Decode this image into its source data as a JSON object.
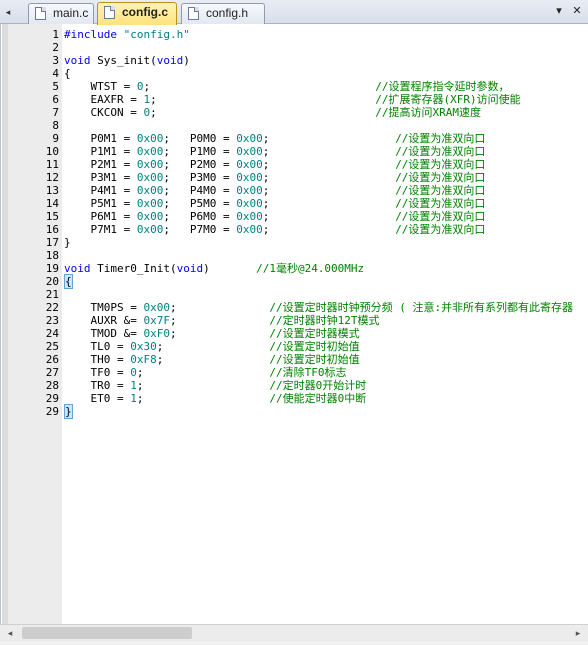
{
  "tabs": [
    {
      "label": "main.c",
      "active": false
    },
    {
      "label": "config.c",
      "active": true
    },
    {
      "label": "config.h",
      "active": false
    }
  ],
  "tabbar": {
    "left_arrow": "◂",
    "dropdown_icon": "▾",
    "close_icon": "✕"
  },
  "colors": {
    "keyword": "#0000ff",
    "number": "#008080",
    "comment": "#008000",
    "active_tab": "#ffe27a"
  },
  "code": [
    {
      "n": "1",
      "segs": [
        [
          "pre",
          "#include "
        ],
        [
          "str",
          "\"config.h\""
        ]
      ]
    },
    {
      "n": "2",
      "segs": []
    },
    {
      "n": "3",
      "segs": [
        [
          "kw",
          "void"
        ],
        [
          "",
          " Sys_init("
        ],
        [
          "kw",
          "void"
        ],
        [
          "",
          ")"
        ]
      ]
    },
    {
      "n": "4",
      "segs": [
        [
          "",
          "{"
        ]
      ]
    },
    {
      "n": "5",
      "segs": [
        [
          "",
          "    WTST = "
        ],
        [
          "num",
          "0"
        ],
        [
          "",
          ";"
        ],
        [
          "",
          "                                  "
        ],
        [
          "cm",
          "//设置程序指令延时参数，"
        ]
      ]
    },
    {
      "n": "6",
      "segs": [
        [
          "",
          "    EAXFR = "
        ],
        [
          "num",
          "1"
        ],
        [
          "",
          ";"
        ],
        [
          "",
          "                                 "
        ],
        [
          "cm",
          "//扩展寄存器(XFR)访问使能"
        ]
      ]
    },
    {
      "n": "7",
      "segs": [
        [
          "",
          "    CKCON = "
        ],
        [
          "num",
          "0"
        ],
        [
          "",
          ";"
        ],
        [
          "",
          "                                 "
        ],
        [
          "cm",
          "//提高访问XRAM速度"
        ]
      ]
    },
    {
      "n": "8",
      "segs": []
    },
    {
      "n": "9",
      "segs": [
        [
          "",
          "    P0M1 = "
        ],
        [
          "num",
          "0x00"
        ],
        [
          "",
          ";   P0M0 = "
        ],
        [
          "num",
          "0x00"
        ],
        [
          "",
          ";"
        ],
        [
          "",
          "                   "
        ],
        [
          "cm",
          "//设置为准双向口"
        ]
      ]
    },
    {
      "n": "10",
      "segs": [
        [
          "",
          "    P1M1 = "
        ],
        [
          "num",
          "0x00"
        ],
        [
          "",
          ";   P1M0 = "
        ],
        [
          "num",
          "0x00"
        ],
        [
          "",
          ";"
        ],
        [
          "",
          "                   "
        ],
        [
          "cm",
          "//设置为准双向口"
        ]
      ]
    },
    {
      "n": "11",
      "segs": [
        [
          "",
          "    P2M1 = "
        ],
        [
          "num",
          "0x00"
        ],
        [
          "",
          ";   P2M0 = "
        ],
        [
          "num",
          "0x00"
        ],
        [
          "",
          ";"
        ],
        [
          "",
          "                   "
        ],
        [
          "cm",
          "//设置为准双向口"
        ]
      ]
    },
    {
      "n": "12",
      "segs": [
        [
          "",
          "    P3M1 = "
        ],
        [
          "num",
          "0x00"
        ],
        [
          "",
          ";   P3M0 = "
        ],
        [
          "num",
          "0x00"
        ],
        [
          "",
          ";"
        ],
        [
          "",
          "                   "
        ],
        [
          "cm",
          "//设置为准双向口"
        ]
      ]
    },
    {
      "n": "13",
      "segs": [
        [
          "",
          "    P4M1 = "
        ],
        [
          "num",
          "0x00"
        ],
        [
          "",
          ";   P4M0 = "
        ],
        [
          "num",
          "0x00"
        ],
        [
          "",
          ";"
        ],
        [
          "",
          "                   "
        ],
        [
          "cm",
          "//设置为准双向口"
        ]
      ]
    },
    {
      "n": "14",
      "segs": [
        [
          "",
          "    P5M1 = "
        ],
        [
          "num",
          "0x00"
        ],
        [
          "",
          ";   P5M0 = "
        ],
        [
          "num",
          "0x00"
        ],
        [
          "",
          ";"
        ],
        [
          "",
          "                   "
        ],
        [
          "cm",
          "//设置为准双向口"
        ]
      ]
    },
    {
      "n": "15",
      "segs": [
        [
          "",
          "    P6M1 = "
        ],
        [
          "num",
          "0x00"
        ],
        [
          "",
          ";   P6M0 = "
        ],
        [
          "num",
          "0x00"
        ],
        [
          "",
          ";"
        ],
        [
          "",
          "                   "
        ],
        [
          "cm",
          "//设置为准双向口"
        ]
      ]
    },
    {
      "n": "16",
      "segs": [
        [
          "",
          "    P7M1 = "
        ],
        [
          "num",
          "0x00"
        ],
        [
          "",
          ";   P7M0 = "
        ],
        [
          "num",
          "0x00"
        ],
        [
          "",
          ";"
        ],
        [
          "",
          "                   "
        ],
        [
          "cm",
          "//设置为准双向口"
        ]
      ]
    },
    {
      "n": "17",
      "segs": [
        [
          "",
          "}"
        ]
      ]
    },
    {
      "n": "18",
      "segs": []
    },
    {
      "n": "19",
      "segs": [
        [
          "kw",
          "void"
        ],
        [
          "",
          " Timer0_Init("
        ],
        [
          "kw",
          "void"
        ],
        [
          "",
          ")"
        ],
        [
          "",
          "       "
        ],
        [
          "cm",
          "//1毫秒@24.000MHz"
        ]
      ]
    },
    {
      "n": "20",
      "segs": [
        [
          "brace",
          "{"
        ]
      ]
    },
    {
      "n": "21",
      "segs": []
    },
    {
      "n": "22",
      "segs": [
        [
          "",
          "    TM0PS = "
        ],
        [
          "num",
          "0x00"
        ],
        [
          "",
          ";"
        ],
        [
          "",
          "              "
        ],
        [
          "cm",
          "//设置定时器时钟预分频 ( 注意:并非所有系列都有此寄存器"
        ]
      ]
    },
    {
      "n": "23",
      "segs": [
        [
          "",
          "    AUXR &= "
        ],
        [
          "num",
          "0x7F"
        ],
        [
          "",
          ";"
        ],
        [
          "",
          "              "
        ],
        [
          "cm",
          "//定时器时钟12T模式"
        ]
      ]
    },
    {
      "n": "24",
      "segs": [
        [
          "",
          "    TMOD &= "
        ],
        [
          "num",
          "0xF0"
        ],
        [
          "",
          ";"
        ],
        [
          "",
          "              "
        ],
        [
          "cm",
          "//设置定时器模式"
        ]
      ]
    },
    {
      "n": "25",
      "segs": [
        [
          "",
          "    TL0 = "
        ],
        [
          "num",
          "0x30"
        ],
        [
          "",
          ";"
        ],
        [
          "",
          "                "
        ],
        [
          "cm",
          "//设置定时初始值"
        ]
      ]
    },
    {
      "n": "26",
      "segs": [
        [
          "",
          "    TH0 = "
        ],
        [
          "num",
          "0xF8"
        ],
        [
          "",
          ";"
        ],
        [
          "",
          "                "
        ],
        [
          "cm",
          "//设置定时初始值"
        ]
      ]
    },
    {
      "n": "27",
      "segs": [
        [
          "",
          "    TF0 = "
        ],
        [
          "num",
          "0"
        ],
        [
          "",
          ";"
        ],
        [
          "",
          "                   "
        ],
        [
          "cm",
          "//清除TF0标志"
        ]
      ]
    },
    {
      "n": "28",
      "segs": [
        [
          "",
          "    TR0 = "
        ],
        [
          "num",
          "1"
        ],
        [
          "",
          ";"
        ],
        [
          "",
          "                   "
        ],
        [
          "cm",
          "//定时器0开始计时"
        ]
      ]
    },
    {
      "n": "29",
      "segs": [
        [
          "",
          "    ET0 = "
        ],
        [
          "num",
          "1"
        ],
        [
          "",
          ";"
        ],
        [
          "",
          "                   "
        ],
        [
          "cm",
          "//使能定时器0中断"
        ]
      ]
    },
    {
      "n": "29",
      "segs": [
        [
          "brace",
          "}"
        ]
      ]
    }
  ],
  "scroll": {
    "left_arrow": "◂",
    "right_arrow": "▸"
  }
}
